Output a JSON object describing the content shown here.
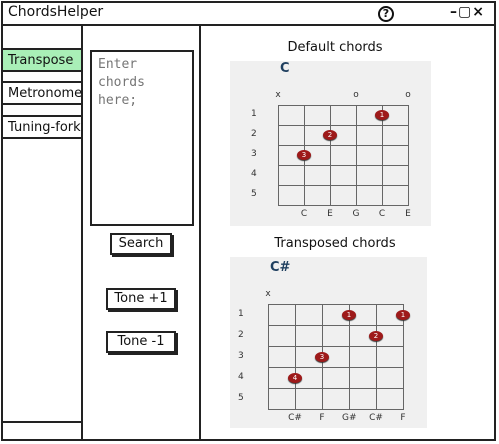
{
  "app": {
    "title": "ChordsHelper",
    "help": "?",
    "controls": "–▢×"
  },
  "sidebar": {
    "items": [
      {
        "label": "Transpose",
        "active": true
      },
      {
        "label": "Metronome",
        "active": false
      },
      {
        "label": "Tuning-fork",
        "active": false
      }
    ]
  },
  "input": {
    "placeholder": "Enter chords here;"
  },
  "buttons": {
    "search": "Search",
    "tone_up": "Tone +1",
    "tone_down": "Tone -1"
  },
  "default_chords": {
    "title": "Default chords",
    "chord": "C",
    "open_marks": [
      "x",
      "",
      "",
      "o",
      "",
      "o"
    ],
    "frets": [
      "1",
      "2",
      "3",
      "4",
      "5"
    ],
    "notes": [
      "C",
      "E",
      "G",
      "C",
      "E"
    ],
    "dots": [
      {
        "string": 5,
        "fret": 1,
        "finger": "1"
      },
      {
        "string": 3,
        "fret": 2,
        "finger": "2"
      },
      {
        "string": 2,
        "fret": 3,
        "finger": "3"
      }
    ]
  },
  "transposed_chords": {
    "title": "Transposed chords",
    "chord": "C#",
    "open_marks": [
      "x",
      "",
      "",
      "",
      "",
      ""
    ],
    "frets": [
      "1",
      "2",
      "3",
      "4",
      "5"
    ],
    "notes": [
      "C#",
      "F",
      "G#",
      "C#",
      "F"
    ],
    "dots": [
      {
        "string": 4,
        "fret": 1,
        "finger": "1"
      },
      {
        "string": 6,
        "fret": 1,
        "finger": "1"
      },
      {
        "string": 5,
        "fret": 2,
        "finger": "2"
      },
      {
        "string": 3,
        "fret": 3,
        "finger": "3"
      },
      {
        "string": 2,
        "fret": 4,
        "finger": "4"
      }
    ]
  }
}
